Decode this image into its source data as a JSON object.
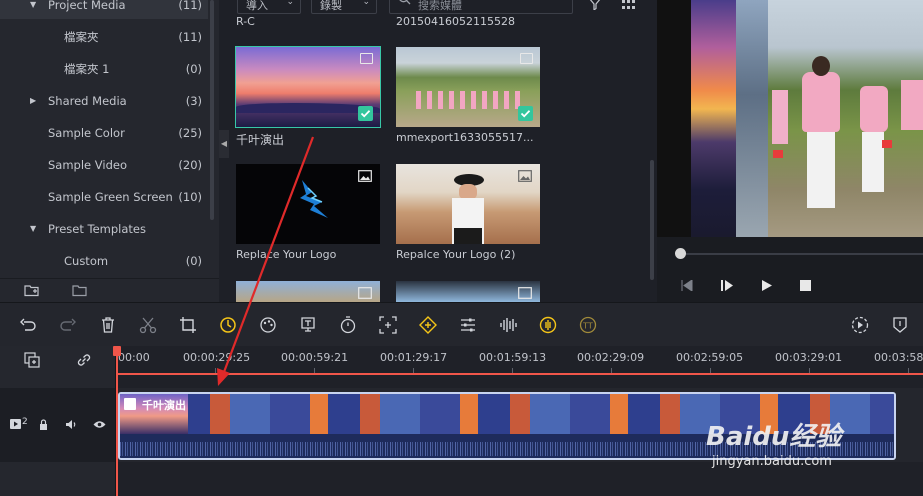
{
  "library": {
    "items": [
      {
        "label": "Project Media",
        "count": "(11)",
        "level": 0,
        "caret": "down",
        "active": true
      },
      {
        "label": "檔案夾",
        "count": "(11)",
        "level": 1
      },
      {
        "label": "檔案夾 1",
        "count": "(0)",
        "level": 1
      },
      {
        "label": "Shared Media",
        "count": "(3)",
        "level": 0,
        "caret": "right"
      },
      {
        "label": "Sample Color",
        "count": "(25)",
        "level": 0
      },
      {
        "label": "Sample Video",
        "count": "(20)",
        "level": 0
      },
      {
        "label": "Sample Green Screen",
        "count": "(10)",
        "level": 0
      },
      {
        "label": "Preset Templates",
        "count": "",
        "level": 0,
        "caret": "down"
      },
      {
        "label": "Custom",
        "count": "(0)",
        "level": 1
      }
    ]
  },
  "media": {
    "import_label": "導入",
    "record_label": "錄製",
    "search_placeholder": "搜索媒體",
    "top_labels": [
      "R-C",
      "20150416052115528"
    ],
    "items": [
      {
        "label": "千叶演出",
        "selected": true
      },
      {
        "label": "mmexport1633055517..."
      },
      {
        "label": "Replace Your Logo"
      },
      {
        "label": "Repalce Your Logo (2)"
      }
    ]
  },
  "timeline": {
    "ticks": [
      "00:00",
      "00:00:29:25",
      "00:00:59:21",
      "00:01:29:17",
      "00:01:59:13",
      "00:02:29:09",
      "00:02:59:05",
      "00:03:29:01",
      "00:03:58"
    ],
    "clip_title": "千叶演出",
    "track_number": "2"
  },
  "watermark": {
    "brand": "Baidu经验",
    "url": "jingyan.baidu.com"
  },
  "colors": {
    "accent": "#38c7a7",
    "playhead": "#f0564a",
    "clip_border": "#c8d4f0"
  }
}
